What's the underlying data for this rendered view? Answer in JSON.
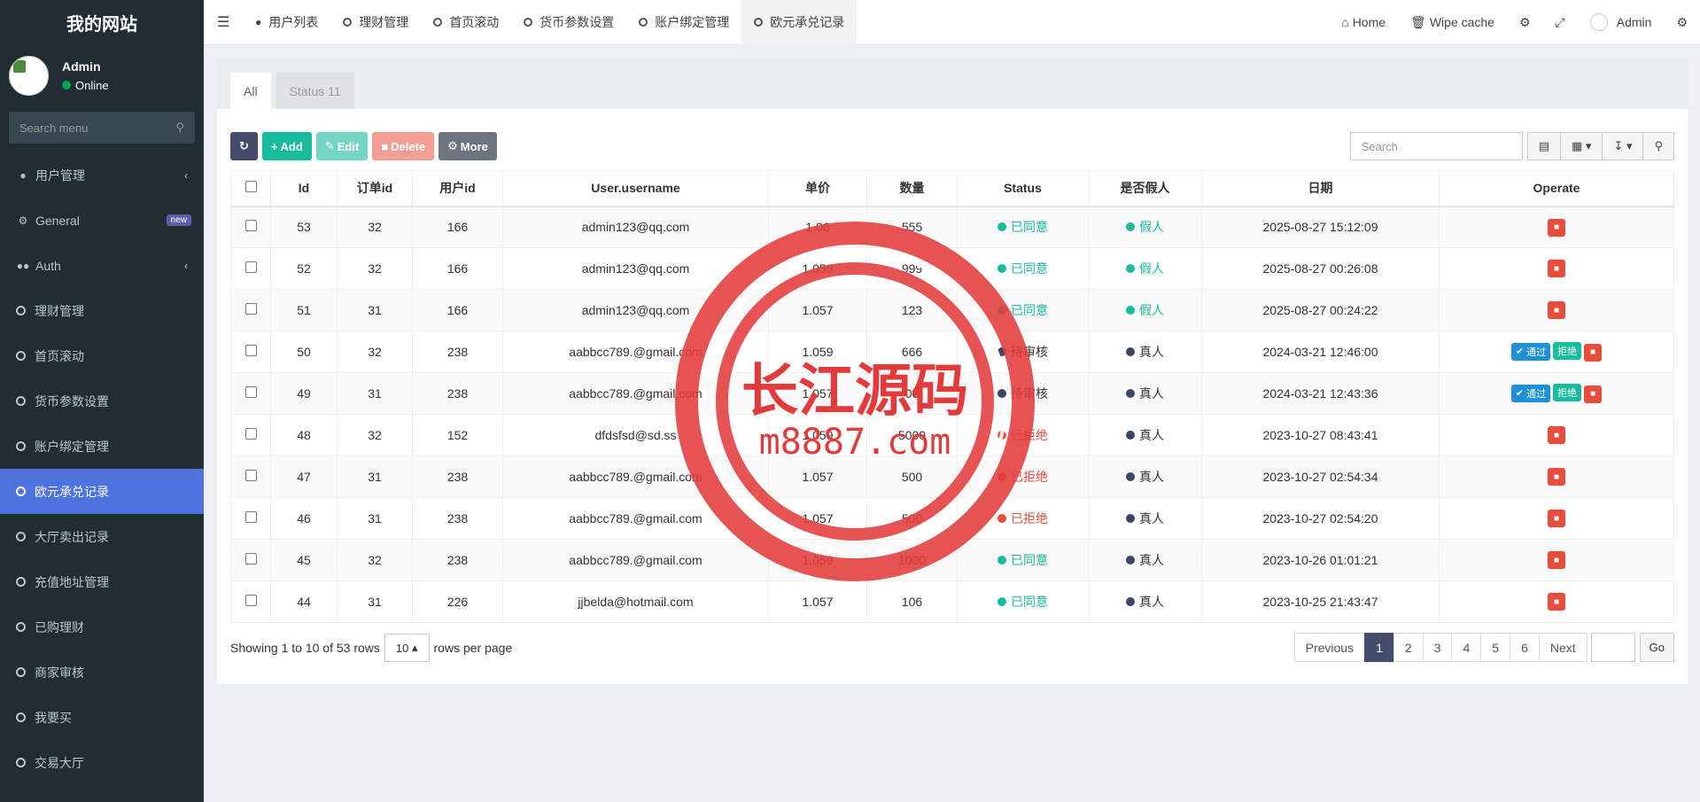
{
  "brand": "我的网站",
  "user": {
    "name": "Admin",
    "status": "Online"
  },
  "sidebar": {
    "search_placeholder": "Search menu",
    "items": [
      {
        "label": "用户管理",
        "icon": "user-circle-icon",
        "chevron": "‹"
      },
      {
        "label": "General",
        "icon": "cogs-icon",
        "badge": "new"
      },
      {
        "label": "Auth",
        "icon": "group-icon",
        "chevron": "‹"
      },
      {
        "label": "理财管理",
        "icon": "circle-icon"
      },
      {
        "label": "首页滚动",
        "icon": "circle-icon"
      },
      {
        "label": "货币参数设置",
        "icon": "circle-icon"
      },
      {
        "label": "账户绑定管理",
        "icon": "circle-icon"
      },
      {
        "label": "欧元承兑记录",
        "icon": "circle-icon",
        "active": true
      },
      {
        "label": "大厅卖出记录",
        "icon": "circle-icon"
      },
      {
        "label": "充值地址管理",
        "icon": "circle-icon"
      },
      {
        "label": "已购理财",
        "icon": "circle-icon"
      },
      {
        "label": "商家审核",
        "icon": "circle-icon"
      },
      {
        "label": "我要买",
        "icon": "circle-icon"
      },
      {
        "label": "交易大厅",
        "icon": "circle-icon"
      }
    ]
  },
  "topnav": {
    "tabs": [
      "用户列表",
      "理财管理",
      "首页滚动",
      "货币参数设置",
      "账户绑定管理",
      "欧元承兑记录"
    ],
    "right": {
      "home": "Home",
      "wipe": "Wipe cache",
      "user": "Admin"
    }
  },
  "panel": {
    "tabs": [
      "All",
      "Status 11"
    ],
    "toolbar": {
      "add": "Add",
      "edit": "Edit",
      "delete": "Delete",
      "more": "More",
      "search_placeholder": "Search"
    }
  },
  "table": {
    "headers": [
      "Id",
      "订单id",
      "用户id",
      "User.username",
      "单价",
      "数量",
      "Status",
      "是否假人",
      "日期",
      "Operate"
    ],
    "rows": [
      {
        "id": "53",
        "order": "32",
        "uid": "166",
        "username": "admin123@qq.com",
        "price": "1.06",
        "qty": "555",
        "status": "已同意",
        "fake": "假人",
        "date": "2025-08-27 15:12:09"
      },
      {
        "id": "52",
        "order": "32",
        "uid": "166",
        "username": "admin123@qq.com",
        "price": "1.059",
        "qty": "999",
        "status": "已同意",
        "fake": "假人",
        "date": "2025-08-27 00:26:08"
      },
      {
        "id": "51",
        "order": "31",
        "uid": "166",
        "username": "admin123@qq.com",
        "price": "1.057",
        "qty": "123",
        "status": "已同意",
        "fake": "假人",
        "date": "2025-08-27 00:24:22"
      },
      {
        "id": "50",
        "order": "32",
        "uid": "238",
        "username": "aabbcc789.@gmail.com",
        "price": "1.059",
        "qty": "666",
        "status": "待审核",
        "fake": "真人",
        "date": "2024-03-21 12:46:00"
      },
      {
        "id": "49",
        "order": "31",
        "uid": "238",
        "username": "aabbcc789.@gmail.com",
        "price": "1.057",
        "qty": "00",
        "status": "待审核",
        "fake": "真人",
        "date": "2024-03-21 12:43:36"
      },
      {
        "id": "48",
        "order": "32",
        "uid": "152",
        "username": "dfdsfsd@sd.ss",
        "price": "1.059",
        "qty": "5000",
        "status": "已拒绝",
        "fake": "真人",
        "date": "2023-10-27 08:43:41"
      },
      {
        "id": "47",
        "order": "31",
        "uid": "238",
        "username": "aabbcc789.@gmail.com",
        "price": "1.057",
        "qty": "500",
        "status": "已拒绝",
        "fake": "真人",
        "date": "2023-10-27 02:54:34"
      },
      {
        "id": "46",
        "order": "31",
        "uid": "238",
        "username": "aabbcc789.@gmail.com",
        "price": "1.057",
        "qty": "500",
        "status": "已拒绝",
        "fake": "真人",
        "date": "2023-10-27 02:54:20"
      },
      {
        "id": "45",
        "order": "32",
        "uid": "238",
        "username": "aabbcc789.@gmail.com",
        "price": "1.059",
        "qty": "1000",
        "status": "已同意",
        "fake": "真人",
        "date": "2023-10-26 01:01:21"
      },
      {
        "id": "44",
        "order": "31",
        "uid": "226",
        "username": "jjbelda@hotmail.com",
        "price": "1.057",
        "qty": "106",
        "status": "已同意",
        "fake": "真人",
        "date": "2023-10-25 21:43:47"
      }
    ],
    "actions": {
      "approve": "通过",
      "reject": "拒绝"
    }
  },
  "pagination": {
    "showing": "Showing 1 to 10 of 53 rows",
    "per_page": "10",
    "per_page_label": "rows per page",
    "prev": "Previous",
    "pages": [
      "1",
      "2",
      "3",
      "4",
      "5",
      "6"
    ],
    "next": "Next",
    "go": "Go"
  },
  "watermark": {
    "line1": "长江源码",
    "line2": "m8887.com"
  },
  "colors": {
    "sidebar": "#222d32",
    "active": "#4e73df",
    "green": "#18bc9c",
    "red": "#e74c3c",
    "dark": "#444c69"
  }
}
